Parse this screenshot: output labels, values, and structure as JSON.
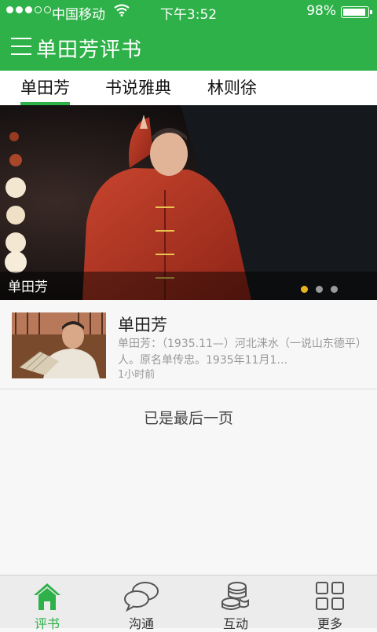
{
  "status": {
    "carrier": "中国移动",
    "time": "下午3:52",
    "battery": "98%",
    "battery_level": 0.98
  },
  "app": {
    "title": "单田芳评书"
  },
  "tabs": [
    {
      "label": "单田芳",
      "active": true
    },
    {
      "label": "书说雅典",
      "active": false
    },
    {
      "label": "林则徐",
      "active": false
    }
  ],
  "banner": {
    "caption": "单田芳",
    "page_count": 3,
    "current_page": 1
  },
  "list": [
    {
      "title": "单田芳",
      "description": "单田芳：（1935.11—）河北涞水（一说山东德平）人。原名单传忠。1935年11月1…",
      "time": "1小时前"
    }
  ],
  "end_text": "已是最后一页",
  "nav": [
    {
      "label": "评书",
      "icon": "home-icon",
      "active": true
    },
    {
      "label": "沟通",
      "icon": "chat-bubbles-icon",
      "active": false
    },
    {
      "label": "互动",
      "icon": "coins-icon",
      "active": false
    },
    {
      "label": "更多",
      "icon": "grid-icon",
      "active": false
    }
  ],
  "colors": {
    "accent": "#2fb149",
    "dot_active": "#e7b520"
  }
}
